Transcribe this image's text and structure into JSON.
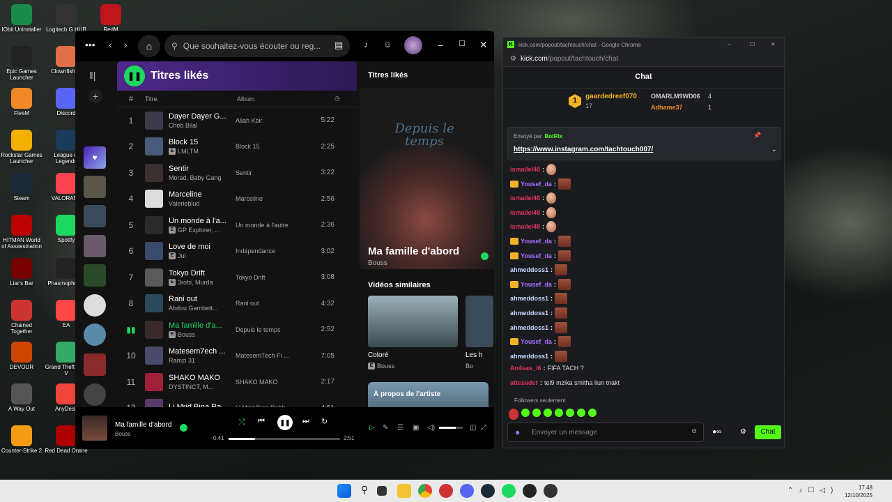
{
  "desktop": {
    "icons": [
      {
        "label": "IObit Uninstaller",
        "color": "#1a8a4a"
      },
      {
        "label": "Logitech G HUB",
        "color": "#333"
      },
      {
        "label": "RedM",
        "color": "#c0161b"
      },
      {
        "label": "Epic Games Launcher",
        "color": "#222"
      },
      {
        "label": "ClownfishVo",
        "color": "#e0704a"
      },
      {
        "label": "FiveM",
        "color": "#f08a28"
      },
      {
        "label": "Discord",
        "color": "#5865f2"
      },
      {
        "label": "Rockstar Games Launcher",
        "color": "#f4b000"
      },
      {
        "label": "League of Legends",
        "color": "#1a3a5a"
      },
      {
        "label": "Steam",
        "color": "#1b2838"
      },
      {
        "label": "VALORANT",
        "color": "#fa4454"
      },
      {
        "label": "HITMAN World of Assassination",
        "color": "#b00"
      },
      {
        "label": "Spotify",
        "color": "#1ed760"
      },
      {
        "label": "Liar's Bar",
        "color": "#700"
      },
      {
        "label": "Phasmophobia",
        "color": "#222"
      },
      {
        "label": "Chained Together",
        "color": "#c33"
      },
      {
        "label": "EA",
        "color": "#ff4747"
      },
      {
        "label": "DEVOUR",
        "color": "#c40"
      },
      {
        "label": "Grand Theft Auto V",
        "color": "#3a6"
      },
      {
        "label": "A Way Out",
        "color": "#555"
      },
      {
        "label": "AnyDesk",
        "color": "#ef443b"
      },
      {
        "label": "Counter-Strike 2",
        "color": "#f39c12"
      },
      {
        "label": "Red Dead Online",
        "color": "#a00"
      }
    ]
  },
  "spotify": {
    "search_placeholder": "Que souhaitez-vous écouter ou reg...",
    "playlist_title": "Titres likés",
    "col_title": "Titre",
    "col_album": "Album",
    "col_hash": "#",
    "tracks": [
      {
        "n": "1",
        "title": "Dayer Dayer G...",
        "artist": "Cheb Bilal",
        "album": "Allah Kbir",
        "dur": "5:22",
        "explicit": false
      },
      {
        "n": "2",
        "title": "Block 15",
        "artist": "LMLTM",
        "album": "Block 15",
        "dur": "2:25",
        "explicit": true
      },
      {
        "n": "3",
        "title": "Sentir",
        "artist": "Morad, Baby Gang",
        "album": "Sentir",
        "dur": "3:22",
        "explicit": false
      },
      {
        "n": "4",
        "title": "Marceline",
        "artist": "Valerieblud",
        "album": "Marceline",
        "dur": "2:56",
        "explicit": false
      },
      {
        "n": "5",
        "title": "Un monde à l'a...",
        "artist": "GP Explorer, ...",
        "album": "Un monde à l'autre",
        "dur": "2:36",
        "explicit": true
      },
      {
        "n": "6",
        "title": "Love de moi",
        "artist": "Jul",
        "album": "Indépendance",
        "dur": "3:02",
        "explicit": true
      },
      {
        "n": "7",
        "title": "Tokyo Drift",
        "artist": "3robi, Murda",
        "album": "Tokyo Drift",
        "dur": "3:08",
        "explicit": true
      },
      {
        "n": "8",
        "title": "Rani out",
        "artist": "Abdou Gambett...",
        "album": "Rani out",
        "dur": "4:32",
        "explicit": false
      },
      {
        "n": "",
        "title": "Ma famille d'a...",
        "artist": "Bouss",
        "album": "Depuis le temps",
        "dur": "2:52",
        "explicit": true
      },
      {
        "n": "10",
        "title": "Matesem7ech ...",
        "artist": "Ramzi 31",
        "album": "Matesem7ech Fi ...",
        "dur": "7:05",
        "explicit": false
      },
      {
        "n": "11",
        "title": "SHAKO MAKO",
        "artist": "DYSTINCT, M...",
        "album": "SHAKO MAKO",
        "dur": "2:17",
        "explicit": false
      },
      {
        "n": "12",
        "title": "Li Mrid Bina Ra...",
        "artist": "",
        "album": "Li Mrid Bina Rabb...",
        "dur": "4:51",
        "explicit": false
      }
    ],
    "right": {
      "header": "Titres likés",
      "album_art_text": "Depuis le temps",
      "song": "Ma famille d'abord",
      "artist": "Bouss",
      "videos_label": "Vidéos similaires",
      "video1_title": "Coloré",
      "video1_artist": "Bouss",
      "video2_title": "Les h",
      "video2_artist": "Bo",
      "about": "À propos de l'artiste"
    },
    "player": {
      "title": "Ma famille d'abord",
      "artist": "Bouss",
      "elapsed": "0:41",
      "total": "2:51",
      "progress": 0.24,
      "volume": 0.7
    }
  },
  "chrome": {
    "title": "kick.com/popout/tachtouch/chat - Google Chrome",
    "url_domain": "kick.com",
    "url_path": "/popout/tachtouch/chat",
    "chat_header": "Chat",
    "leaderboard": {
      "top_name": "gaardedreef070",
      "top_count": "17",
      "rank": "1",
      "second": "OMARLM9WD06",
      "second_count": "4",
      "third": "Adhame37",
      "third_count": "1"
    },
    "pinned": {
      "label": "Envoyé par",
      "sender": "BotRix",
      "link": "https://www.instagram.com/tachtouch007/"
    },
    "messages": [
      {
        "user": "ismailel48",
        "color": "#e0345c",
        "crown": false,
        "text": "",
        "emote": "egg"
      },
      {
        "user": "Yousef_da",
        "color": "#a970ff",
        "crown": true,
        "text": "",
        "emote": "face"
      },
      {
        "user": "ismailel48",
        "color": "#e0345c",
        "crown": false,
        "text": "",
        "emote": "egg"
      },
      {
        "user": "ismailel48",
        "color": "#e0345c",
        "crown": false,
        "text": "",
        "emote": "egg"
      },
      {
        "user": "ismailel48",
        "color": "#e0345c",
        "crown": false,
        "text": "",
        "emote": "egg"
      },
      {
        "user": "Yousef_da",
        "color": "#a970ff",
        "crown": true,
        "text": "",
        "emote": "face"
      },
      {
        "user": "Yousef_da",
        "color": "#a970ff",
        "crown": true,
        "text": "",
        "emote": "face"
      },
      {
        "user": "ahmeddoss1",
        "color": "#c9d7ff",
        "crown": false,
        "text": "",
        "emote": "face"
      },
      {
        "user": "Yousef_da",
        "color": "#a970ff",
        "crown": true,
        "text": "",
        "emote": "face"
      },
      {
        "user": "ahmeddoss1",
        "color": "#c9d7ff",
        "crown": false,
        "text": "",
        "emote": "face"
      },
      {
        "user": "ahmeddoss1",
        "color": "#c9d7ff",
        "crown": false,
        "text": "",
        "emote": "face"
      },
      {
        "user": "ahmeddoss1",
        "color": "#c9d7ff",
        "crown": false,
        "text": "",
        "emote": "face"
      },
      {
        "user": "Yousef_da",
        "color": "#a970ff",
        "crown": true,
        "text": "",
        "emote": "face"
      },
      {
        "user": "ahmeddoss1",
        "color": "#c9d7ff",
        "crown": false,
        "text": "",
        "emote": "face"
      },
      {
        "user": "An4sas_i6",
        "color": "#e0345c",
        "crown": false,
        "text": "FIFA TACH ?",
        "emote": ""
      },
      {
        "user": "attesader",
        "color": "#e0345c",
        "crown": false,
        "text": "tel9 mzika smitha liun tnakt",
        "emote": ""
      }
    ],
    "followers_only": "Followers seulement",
    "input_placeholder": "Envoyer un message",
    "send_label": "Chat"
  },
  "taskbar": {
    "time": "17:48",
    "date": "12/10/2025"
  }
}
